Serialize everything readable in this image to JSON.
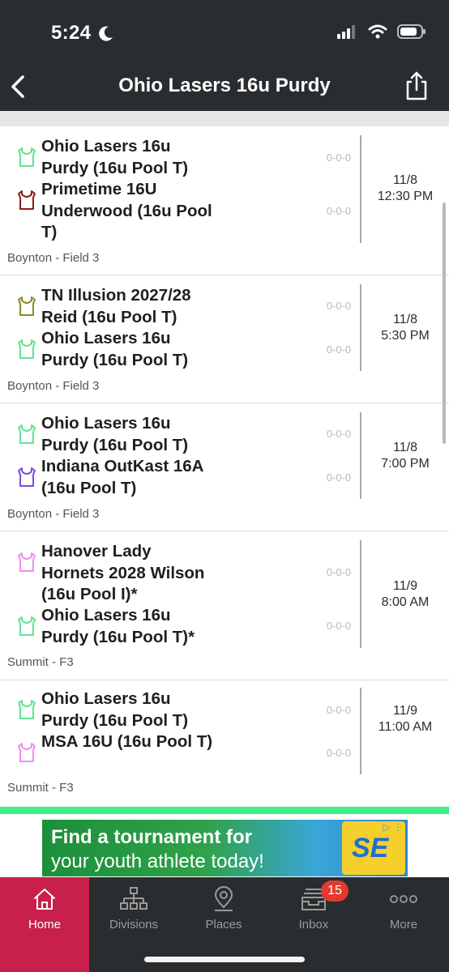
{
  "status": {
    "time": "5:24"
  },
  "nav": {
    "title": "Ohio Lasers 16u Purdy"
  },
  "games": [
    {
      "teams": [
        {
          "name": "Ohio Lasers 16u Purdy (16u Pool T)",
          "jersey_color": "#5fe38d",
          "record": "0-0-0"
        },
        {
          "name": "Primetime 16U Underwood (16u Pool T)",
          "jersey_color": "#8b1a1a",
          "record": "0-0-0"
        }
      ],
      "date": "11/8",
      "time": "12:30 PM",
      "venue": "Boynton - Field 3"
    },
    {
      "teams": [
        {
          "name": "TN Illusion 2027/28 Reid (16u Pool T)",
          "jersey_color": "#8a8a2a",
          "record": "0-0-0"
        },
        {
          "name": "Ohio Lasers 16u Purdy (16u Pool T)",
          "jersey_color": "#5fe38d",
          "record": "0-0-0"
        }
      ],
      "date": "11/8",
      "time": "5:30 PM",
      "venue": "Boynton - Field 3"
    },
    {
      "teams": [
        {
          "name": "Ohio Lasers 16u Purdy (16u Pool T)",
          "jersey_color": "#5fe38d",
          "record": "0-0-0"
        },
        {
          "name": "Indiana OutKast 16A (16u Pool T)",
          "jersey_color": "#7e4ae0",
          "record": "0-0-0"
        }
      ],
      "date": "11/8",
      "time": "7:00 PM",
      "venue": "Boynton - Field 3"
    },
    {
      "teams": [
        {
          "name": "Hanover Lady Hornets 2028 Wilson (16u Pool I)*",
          "jersey_color": "#f08cf0",
          "record": "0-0-0"
        },
        {
          "name": "Ohio Lasers 16u Purdy (16u Pool T)*",
          "jersey_color": "#5fe38d",
          "record": "0-0-0"
        }
      ],
      "date": "11/9",
      "time": "8:00 AM",
      "venue": "Summit - F3"
    },
    {
      "teams": [
        {
          "name": "Ohio Lasers 16u Purdy (16u Pool T)",
          "jersey_color": "#5fe38d",
          "record": "0-0-0"
        },
        {
          "name": "MSA 16U (16u Pool T)",
          "jersey_color": "#f08cf0",
          "record": "0-0-0"
        }
      ],
      "date": "11/9",
      "time": "11:00 AM",
      "venue": "Summit - F3"
    }
  ],
  "ad": {
    "line1": "Find a tournament for",
    "line2": "your youth athlete today!",
    "logo_text": "SE"
  },
  "tabs": [
    {
      "label": "Home",
      "icon": "home-icon"
    },
    {
      "label": "Divisions",
      "icon": "hierarchy-icon"
    },
    {
      "label": "Places",
      "icon": "map-pin-icon"
    },
    {
      "label": "Inbox",
      "icon": "inbox-icon"
    },
    {
      "label": "More",
      "icon": "more-icon"
    }
  ],
  "inbox_badge": "15",
  "colors": {
    "nav_bg": "#2a2d2f",
    "active_tab": "#c8204a",
    "accent_green": "#3cf088"
  }
}
